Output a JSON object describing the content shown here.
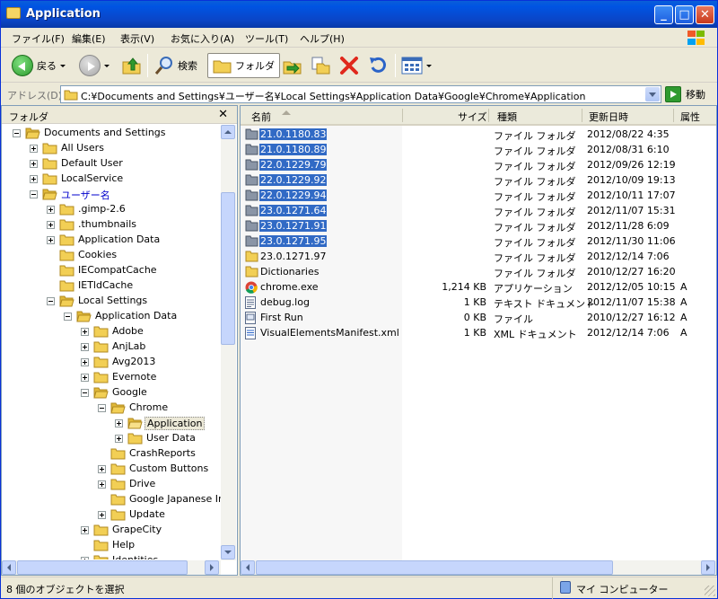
{
  "window": {
    "title": "Application"
  },
  "menu": [
    "ファイル(F)",
    "編集(E)",
    "表示(V)",
    "お気に入り(A)",
    "ツール(T)",
    "ヘルプ(H)"
  ],
  "toolbar": {
    "back_label": "戻る",
    "search_label": "検索",
    "folders_label": "フォルダ"
  },
  "address": {
    "label": "アドレス(D)",
    "path": "C:¥Documents and Settings¥ユーザー名¥Local Settings¥Application Data¥Google¥Chrome¥Application",
    "go_label": "移動"
  },
  "folder_pane": {
    "title": "フォルダ",
    "items": [
      {
        "label": "Documents and Settings",
        "expander": "minus"
      },
      {
        "label": "All Users",
        "expander": "plus"
      },
      {
        "label": "Default User",
        "expander": "plus"
      },
      {
        "label": "LocalService",
        "expander": "plus"
      },
      {
        "label": "ユーザー名",
        "expander": "minus"
      },
      {
        "label": ".gimp-2.6",
        "expander": "plus"
      },
      {
        "label": ".thumbnails",
        "expander": "plus"
      },
      {
        "label": "Application Data",
        "expander": "plus"
      },
      {
        "label": "Cookies",
        "expander": "none"
      },
      {
        "label": "IECompatCache",
        "expander": "none"
      },
      {
        "label": "IETldCache",
        "expander": "none"
      },
      {
        "label": "Local Settings",
        "expander": "minus"
      },
      {
        "label": "Application Data",
        "expander": "minus"
      },
      {
        "label": "Adobe",
        "expander": "plus"
      },
      {
        "label": "AnjLab",
        "expander": "plus"
      },
      {
        "label": "Avg2013",
        "expander": "plus"
      },
      {
        "label": "Evernote",
        "expander": "plus"
      },
      {
        "label": "Google",
        "expander": "minus"
      },
      {
        "label": "Chrome",
        "expander": "minus"
      },
      {
        "label": "Application",
        "expander": "plus"
      },
      {
        "label": "User Data",
        "expander": "plus"
      },
      {
        "label": "CrashReports",
        "expander": "none"
      },
      {
        "label": "Custom Buttons",
        "expander": "plus"
      },
      {
        "label": "Drive",
        "expander": "plus"
      },
      {
        "label": "Google Japanese Input",
        "expander": "none"
      },
      {
        "label": "Update",
        "expander": "plus"
      },
      {
        "label": "GrapeCity",
        "expander": "plus"
      },
      {
        "label": "Help",
        "expander": "none"
      },
      {
        "label": "Identities",
        "expander": "plus"
      }
    ]
  },
  "columns": {
    "name": "名前",
    "size": "サイズ",
    "type": "種類",
    "modified": "更新日時",
    "attr": "属性"
  },
  "files": [
    {
      "name": "21.0.1180.83",
      "size": "",
      "type": "ファイル フォルダ",
      "modified": "2012/08/22 4:35",
      "attr": "",
      "icon": "folder-dark",
      "selected": true
    },
    {
      "name": "21.0.1180.89",
      "size": "",
      "type": "ファイル フォルダ",
      "modified": "2012/08/31 6:10",
      "attr": "",
      "icon": "folder-dark",
      "selected": true
    },
    {
      "name": "22.0.1229.79",
      "size": "",
      "type": "ファイル フォルダ",
      "modified": "2012/09/26 12:19",
      "attr": "",
      "icon": "folder-dark",
      "selected": true
    },
    {
      "name": "22.0.1229.92",
      "size": "",
      "type": "ファイル フォルダ",
      "modified": "2012/10/09 19:13",
      "attr": "",
      "icon": "folder-dark",
      "selected": true
    },
    {
      "name": "22.0.1229.94",
      "size": "",
      "type": "ファイル フォルダ",
      "modified": "2012/10/11 17:07",
      "attr": "",
      "icon": "folder-dark",
      "selected": true
    },
    {
      "name": "23.0.1271.64",
      "size": "",
      "type": "ファイル フォルダ",
      "modified": "2012/11/07 15:31",
      "attr": "",
      "icon": "folder-dark",
      "selected": true
    },
    {
      "name": "23.0.1271.91",
      "size": "",
      "type": "ファイル フォルダ",
      "modified": "2012/11/28 6:09",
      "attr": "",
      "icon": "folder-dark",
      "selected": true
    },
    {
      "name": "23.0.1271.95",
      "size": "",
      "type": "ファイル フォルダ",
      "modified": "2012/11/30 11:06",
      "attr": "",
      "icon": "folder-dark",
      "selected": true
    },
    {
      "name": "23.0.1271.97",
      "size": "",
      "type": "ファイル フォルダ",
      "modified": "2012/12/14 7:06",
      "attr": "",
      "icon": "folder",
      "selected": false
    },
    {
      "name": "Dictionaries",
      "size": "",
      "type": "ファイル フォルダ",
      "modified": "2010/12/27 16:20",
      "attr": "",
      "icon": "folder",
      "selected": false
    },
    {
      "name": "chrome.exe",
      "size": "1,214 KB",
      "type": "アプリケーション",
      "modified": "2012/12/05 10:15",
      "attr": "A",
      "icon": "chrome",
      "selected": false
    },
    {
      "name": "debug.log",
      "size": "1 KB",
      "type": "テキスト ドキュメント",
      "modified": "2012/11/07 15:38",
      "attr": "A",
      "icon": "text",
      "selected": false
    },
    {
      "name": "First Run",
      "size": "0 KB",
      "type": "ファイル",
      "modified": "2010/12/27 16:12",
      "attr": "A",
      "icon": "file",
      "selected": false
    },
    {
      "name": "VisualElementsManifest.xml",
      "size": "1 KB",
      "type": "XML ドキュメント",
      "modified": "2012/12/14 7:06",
      "attr": "A",
      "icon": "xml",
      "selected": false
    }
  ],
  "status": {
    "left": "8 個のオブジェクトを選択",
    "right": "マイ コンピューター"
  }
}
